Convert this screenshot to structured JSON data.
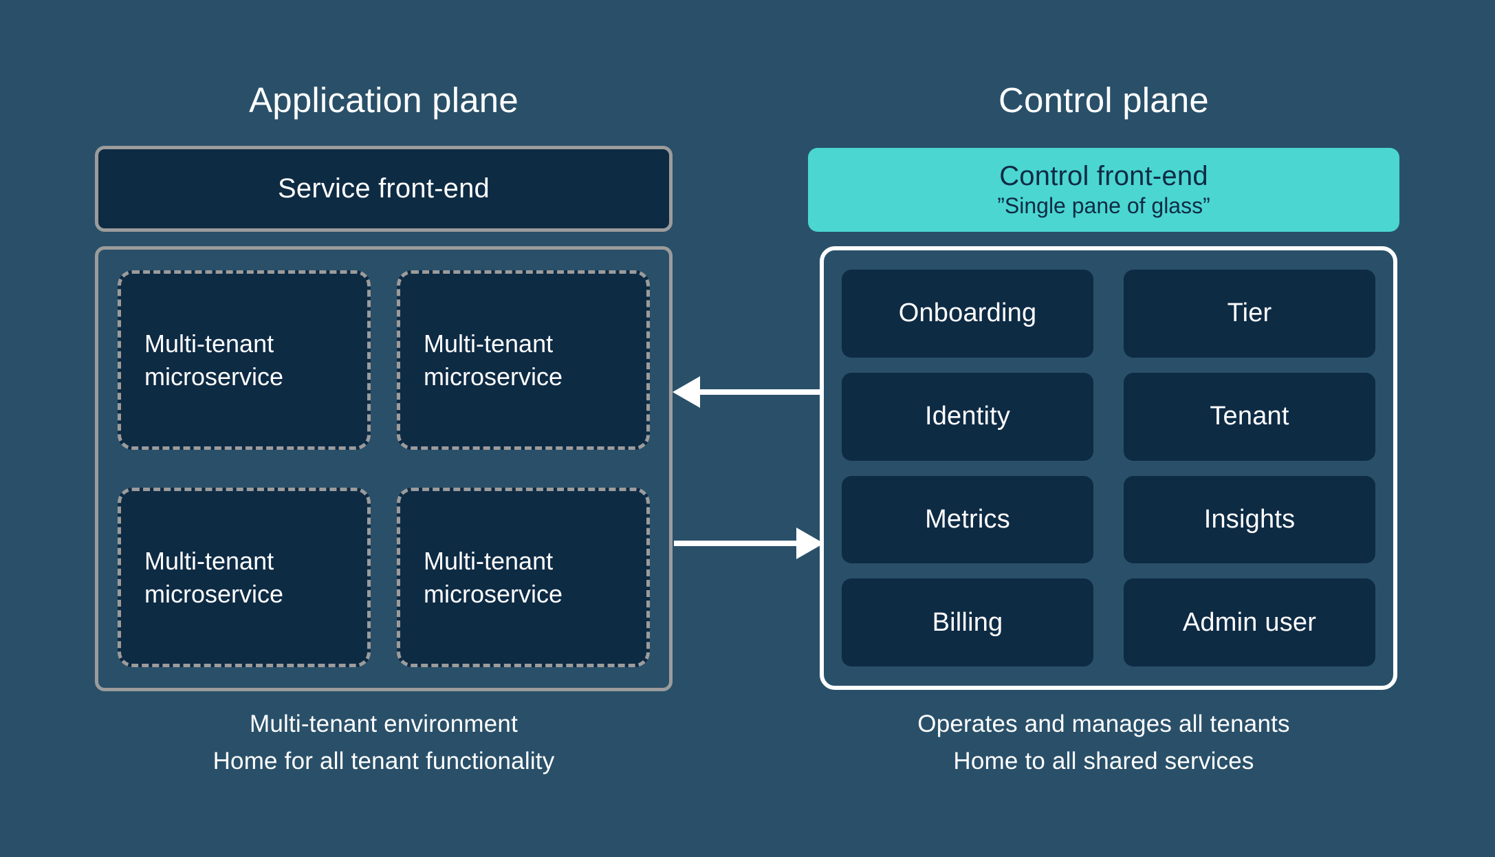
{
  "diagram": {
    "background_color": "#2a5069",
    "dark_box_color": "#0e2b44",
    "accent_teal": "#4bd6d2",
    "border_grey": "#9c9c9c",
    "border_white": "#ffffff"
  },
  "application_plane": {
    "title": "Application plane",
    "front_end": {
      "label": "Service front-end"
    },
    "microservices": [
      {
        "label": "Multi-tenant\nmicroservice"
      },
      {
        "label": "Multi-tenant\nmicroservice"
      },
      {
        "label": "Multi-tenant\nmicroservice"
      },
      {
        "label": "Multi-tenant\nmicroservice"
      }
    ],
    "caption": {
      "line1": "Multi-tenant environment",
      "line2": "Home for all tenant functionality"
    }
  },
  "control_plane": {
    "title": "Control plane",
    "front_end": {
      "title": "Control front-end",
      "subtitle": "”Single pane of glass”"
    },
    "services": [
      {
        "label": "Onboarding"
      },
      {
        "label": "Tier"
      },
      {
        "label": "Identity"
      },
      {
        "label": "Tenant"
      },
      {
        "label": "Metrics"
      },
      {
        "label": "Insights"
      },
      {
        "label": "Billing"
      },
      {
        "label": "Admin user"
      }
    ],
    "caption": {
      "line1": "Operates and manages all tenants",
      "line2": "Home to all shared services"
    }
  },
  "connectors": [
    {
      "name": "control-to-application",
      "direction": "left",
      "color": "#ffffff"
    },
    {
      "name": "application-to-control",
      "direction": "right",
      "color": "#ffffff"
    }
  ]
}
